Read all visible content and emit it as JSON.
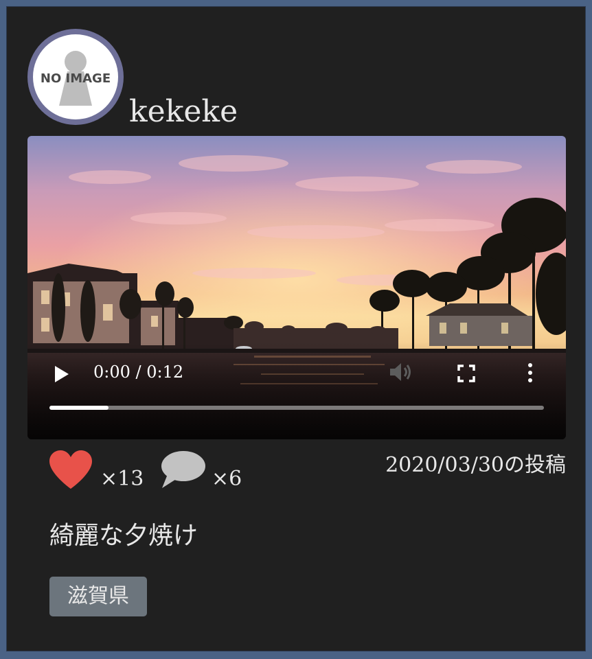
{
  "post": {
    "username": "kekeke",
    "avatar_label": "NO IMAGE",
    "likes": "×13",
    "comments": "×6",
    "posted_date": "2020/03/30の投稿",
    "caption": "綺麗な夕焼け",
    "tag": "滋賀県"
  },
  "video": {
    "time_display": "0:00 / 0:12",
    "progress_fraction": 0.12
  },
  "icons": {
    "avatar": "no-image-placeholder",
    "like": "heart-icon",
    "comment": "speech-bubble-icon",
    "play": "play-icon",
    "volume": "volume-icon",
    "fullscreen": "fullscreen-icon",
    "more": "more-vertical-icon"
  },
  "colors": {
    "card_background": "#202020",
    "page_background": "#4a6285",
    "avatar_ring": "#6e6f98",
    "like": "#e8524a",
    "comment": "#c2c2c2",
    "tag_background": "#6c757d",
    "text": "#e8e8e8"
  }
}
